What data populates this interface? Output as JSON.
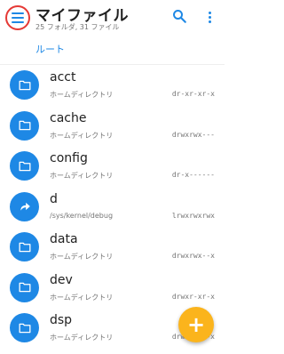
{
  "appbar": {
    "title": "マイファイル",
    "subtitle": "25 フォルダ, 31 ファイル",
    "breadcrumb": "ルート"
  },
  "files": [
    {
      "name": "acct",
      "desc": "ホームディレクトリ",
      "perm": "dr-xr-xr-x",
      "icon": "folder-icon"
    },
    {
      "name": "cache",
      "desc": "ホームディレクトリ",
      "perm": "drwxrwx---",
      "icon": "folder-icon"
    },
    {
      "name": "config",
      "desc": "ホームディレクトリ",
      "perm": "dr-x------",
      "icon": "folder-icon"
    },
    {
      "name": "d",
      "desc": "/sys/kernel/debug",
      "perm": "lrwxrwxrwx",
      "icon": "symlink-icon"
    },
    {
      "name": "data",
      "desc": "ホームディレクトリ",
      "perm": "drwxrwx--x",
      "icon": "folder-icon"
    },
    {
      "name": "dev",
      "desc": "ホームディレクトリ",
      "perm": "drwxr-xr-x",
      "icon": "folder-icon"
    },
    {
      "name": "dsp",
      "desc": "ホームディレクトリ",
      "perm": "drwxr-xr-x",
      "icon": "folder-icon"
    }
  ],
  "fab": {
    "label": "+"
  },
  "colors": {
    "accent": "#1e88e5",
    "fab": "#fbb41c",
    "highlight": "#e53935"
  }
}
